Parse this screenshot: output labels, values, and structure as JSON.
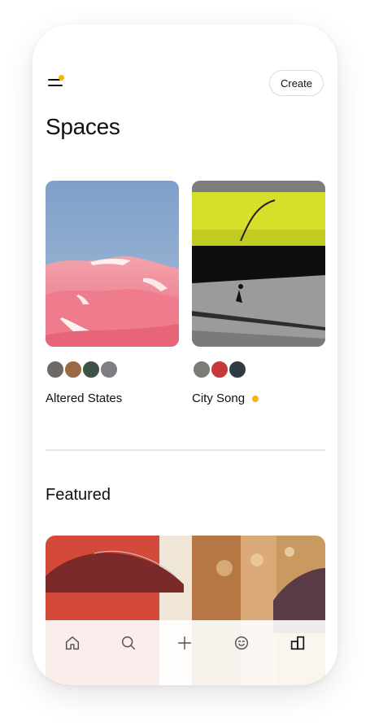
{
  "header": {
    "create_label": "Create",
    "menu_icon": "menu-icon",
    "notification_color": "#f2b705"
  },
  "page": {
    "title": "Spaces"
  },
  "spaces": [
    {
      "title": "Altered States",
      "has_new": false,
      "image": "pink-desert-dunes"
    },
    {
      "title": "City Song",
      "has_new": true,
      "image": "skater-yellow-wall"
    }
  ],
  "featured": {
    "title": "Featured",
    "image": "umbrellas-collage"
  },
  "tabbar": {
    "items": [
      "home-icon",
      "search-icon",
      "plus-icon",
      "smiley-icon",
      "spaces-icon"
    ],
    "active_index": 4
  },
  "colors": {
    "accent": "#f2b705",
    "text": "#111111",
    "divider": "#e6e6e6"
  }
}
